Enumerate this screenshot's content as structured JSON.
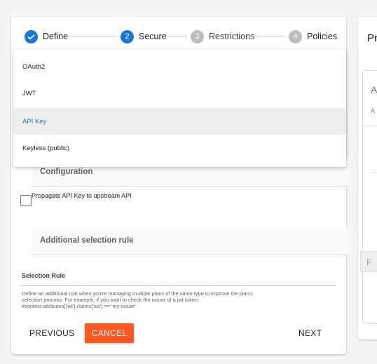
{
  "stepper": {
    "steps": [
      {
        "number": "",
        "label": "Define",
        "state": "completed"
      },
      {
        "number": "2",
        "label": "Secure",
        "state": "active"
      },
      {
        "number": "3",
        "label": "Restrictions",
        "state": "inactive"
      },
      {
        "number": "4",
        "label": "Policies",
        "state": "inactive"
      }
    ]
  },
  "security_menu": {
    "items": [
      "OAuth2",
      "JWT",
      "API Key",
      "Keyless (public)"
    ],
    "selected": "API Key"
  },
  "configuration": {
    "title": "Configuration",
    "propagate_label": "Propagate API Key to upstream API",
    "propagate_checked": false
  },
  "additional_rule": {
    "title": "Additional selection rule",
    "field_label": "Selection Rule",
    "field_value": "",
    "help_line1": "Define an additional rule when you're managing multiple plans of the same type to improve the plan's",
    "help_line2": "selection process. For example, if you want to check the issuer of a jwt token:",
    "help_line3": "#context.attributes['jwt'].claims['iss'] == 'my-issuer'"
  },
  "actions": {
    "previous": "PREVIOUS",
    "cancel": "CANCEL",
    "next": "NEXT"
  },
  "right_panel": {
    "title": "Pr",
    "inner_heading": "A",
    "inner_sub": "A",
    "button": "F"
  },
  "colors": {
    "primary": "#1976d2",
    "accent": "#ff5722",
    "inactive_step": "#bdbdbd"
  }
}
